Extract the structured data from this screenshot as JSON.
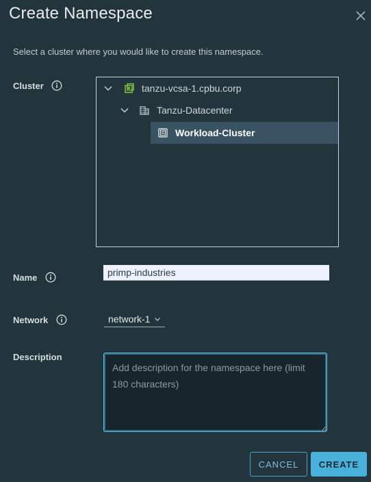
{
  "dialog": {
    "title": "Create Namespace",
    "subtitle": "Select a cluster where you would like to create this namespace."
  },
  "fields": {
    "cluster_label": "Cluster",
    "name_label": "Name",
    "network_label": "Network",
    "description_label": "Description",
    "name_value": "primp-industries",
    "network_value": "network-1",
    "description_placeholder": "Add description for the namespace here (limit 180 characters)"
  },
  "tree": {
    "items": [
      {
        "label": "tanzu-vcsa-1.cpbu.corp",
        "icon": "vcenter-icon",
        "expanded": true
      },
      {
        "label": "Tanzu-Datacenter",
        "icon": "datacenter-icon",
        "expanded": true
      },
      {
        "label": "Workload-Cluster",
        "icon": "cluster-icon",
        "selected": true
      }
    ]
  },
  "buttons": {
    "cancel": "CANCEL",
    "create": "CREATE"
  },
  "colors": {
    "accent": "#49b0d9",
    "background": "#22343c",
    "selected_row": "#3a5362",
    "vcenter_icon": "#7fbf3f"
  }
}
